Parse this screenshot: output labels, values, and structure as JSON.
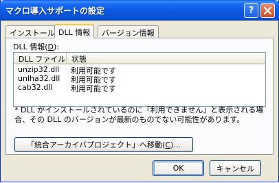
{
  "window": {
    "title": "マクロ導入サポートの設定",
    "help_glyph": "?",
    "close_icon": "close-icon"
  },
  "tabs": [
    {
      "label": "インストール",
      "active": false
    },
    {
      "label": "DLL 情報",
      "active": true
    },
    {
      "label": "バージョン情報",
      "active": false
    }
  ],
  "dll_section": {
    "label_prefix": "DLL 情報(",
    "label_mnemonic": "D",
    "label_suffix": "):",
    "columns": [
      "DLL ファイル",
      "状態"
    ],
    "rows": [
      {
        "file": "unzip32.dll",
        "status": "利用可能です"
      },
      {
        "file": "unlha32.dll",
        "status": "利用可能です"
      },
      {
        "file": "cab32.dll",
        "status": "利用可能です"
      }
    ]
  },
  "note": "* DLL がインストールされているのに「利用できません」と表示される場合、その DLL のバージョンが最新のものでない可能性があります。",
  "buttons": {
    "move_prefix": "「統合アーカイバプロジェクト」へ移動(",
    "move_mnemonic": "C",
    "move_suffix": ")...",
    "ok": "OK",
    "cancel": "キャンセル"
  },
  "colors": {
    "titlebar": "#0b58e3",
    "dialog_bg": "#ece9d8",
    "tab_highlight": "#ffc83c"
  }
}
